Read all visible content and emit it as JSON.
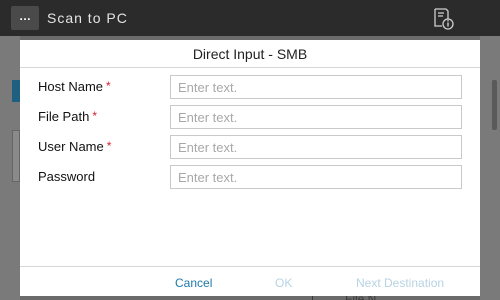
{
  "topbar": {
    "menu_label": "…",
    "title": "Scan to PC",
    "status_icon": "document-info-icon"
  },
  "background": {
    "bottom_text": "File N..."
  },
  "dialog": {
    "title": "Direct Input - SMB",
    "required_mark": "*",
    "fields": [
      {
        "label": "Host Name",
        "placeholder": "Enter text.",
        "required": true
      },
      {
        "label": "File Path",
        "placeholder": "Enter text.",
        "required": true
      },
      {
        "label": "User Name",
        "placeholder": "Enter text.",
        "required": true
      },
      {
        "label": "Password",
        "placeholder": "Enter text.",
        "required": false
      }
    ],
    "buttons": {
      "cancel": "Cancel",
      "ok": "OK",
      "next": "Next Destination"
    }
  },
  "colors": {
    "accent": "#1e7aa8",
    "disabled": "#b7d3e3",
    "required": "#d21f2b",
    "topbar": "#2b2b2b"
  }
}
